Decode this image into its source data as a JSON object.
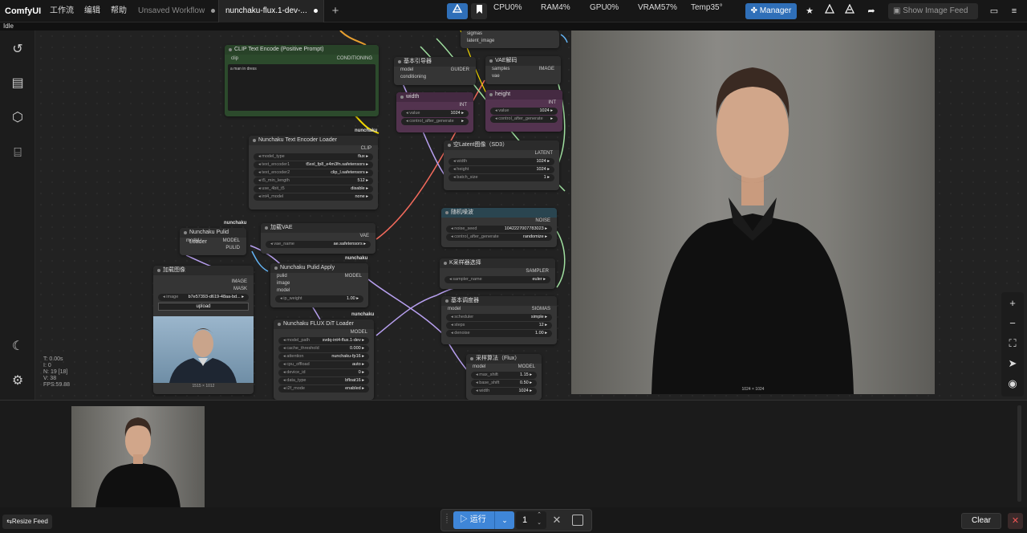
{
  "app": {
    "brand": "ComfyUI",
    "status": "Idle"
  },
  "menu": [
    "工作流",
    "编辑",
    "帮助"
  ],
  "tabs": [
    {
      "label": "Unsaved Workflow",
      "active": false
    },
    {
      "label": "nunchaku-flux.1-dev-...",
      "active": true
    }
  ],
  "system_stats": {
    "cpu": "CPU0%",
    "ram": "RAM4%",
    "gpu": "GPU0%",
    "vram": "VRAM57%",
    "temp": "Temp35°"
  },
  "toolbar": {
    "manager_label": "Manager",
    "show_feed_label": "Show Image Feed"
  },
  "stats_overlay": [
    "T: 0.00s",
    "I: 0",
    "N: 19 [18]",
    "V: 38",
    "FPS:59.88"
  ],
  "nodes": {
    "clip_text_encode": {
      "title": "CLIP Text Encode (Positive Prompt)",
      "in": "clip",
      "out": "CONDITIONING",
      "text": "a man in dress"
    },
    "text_encoder_loader": {
      "title": "Nunchaku Text Encoder Loader",
      "out": "CLIP",
      "tag": "nunchaku",
      "widgets": [
        [
          "model_type",
          "flux"
        ],
        [
          "text_encoder1",
          "t5xxl_fp8_e4m3fn.safetensors"
        ],
        [
          "text_encoder2",
          "clip_l.safetensors"
        ],
        [
          "t5_min_length",
          "512"
        ],
        [
          "use_4bit_t5",
          "disable"
        ],
        [
          "int4_model",
          "none"
        ]
      ]
    },
    "load_vae": {
      "title": "加载VAE",
      "out": "VAE",
      "widgets": [
        [
          "vae_name",
          "ae.safetensors"
        ]
      ]
    },
    "pulid_loader": {
      "title": "Nunchaku Pulid Loader",
      "in": "model",
      "outs": [
        "MODEL",
        "PULID"
      ],
      "tag": "nunchaku"
    },
    "pulid_apply": {
      "title": "Nunchaku Pulid Apply",
      "ins": [
        "pulid",
        "image",
        "model"
      ],
      "out": "MODEL",
      "tag": "nunchaku",
      "widgets": [
        [
          "ip_weight",
          "1.00"
        ]
      ]
    },
    "load_image": {
      "title": "加载图像",
      "outs": [
        "IMAGE",
        "MASK"
      ],
      "widgets": [
        [
          "image",
          "b7e57393-d619-48aa-bd..."
        ]
      ],
      "upload": "upload",
      "caption": "1515 × 1012"
    },
    "dit_loader": {
      "title": "Nunchaku FLUX DiT Loader",
      "out": "MODEL",
      "tag": "nunchaku",
      "widgets": [
        [
          "model_path",
          "svdq-int4-flux.1-dev"
        ],
        [
          "cache_threshold",
          "0.000"
        ],
        [
          "attention",
          "nunchaku-fp16"
        ],
        [
          "cpu_offload",
          "auto"
        ],
        [
          "device_id",
          "0"
        ],
        [
          "data_type",
          "bfloat16"
        ],
        [
          "i2f_mode",
          "enabled"
        ]
      ]
    },
    "basic_guider": {
      "title": "基本引导器",
      "ins": [
        "model",
        "conditioning"
      ],
      "out": "GUIDER"
    },
    "vae_decode": {
      "title": "VAE解码",
      "ins": [
        "samples",
        "vae"
      ],
      "out": "IMAGE"
    },
    "width": {
      "title": "width",
      "out": "INT",
      "widgets": [
        [
          "value",
          "1024"
        ],
        [
          "control_after_generate",
          ""
        ]
      ]
    },
    "height": {
      "title": "height",
      "out": "INT",
      "widgets": [
        [
          "value",
          "1024"
        ],
        [
          "control_after_generate",
          ""
        ]
      ]
    },
    "top_partial": {
      "ins": [
        "sigmas",
        "latent_image"
      ]
    },
    "empty_latent": {
      "title": "空Latent图像（SD3）",
      "out": "LATENT",
      "widgets": [
        [
          "width",
          "1024"
        ],
        [
          "height",
          "1024"
        ],
        [
          "batch_size",
          "1"
        ]
      ]
    },
    "random_noise": {
      "title": "随机噪波",
      "out": "NOISE",
      "widgets": [
        [
          "noise_seed",
          "1042227007783023"
        ],
        [
          "control_after_generate",
          "randomize"
        ]
      ]
    },
    "ksampler_select": {
      "title": "K采样器选择",
      "out": "SAMPLER",
      "widgets": [
        [
          "sampler_name",
          "euler"
        ]
      ]
    },
    "basic_scheduler": {
      "title": "基本调度器",
      "in": "model",
      "out": "SIGMAS",
      "widgets": [
        [
          "scheduler",
          "simple"
        ],
        [
          "steps",
          "12"
        ],
        [
          "denoise",
          "1.00"
        ]
      ]
    },
    "model_sampling_flux": {
      "title": "采样算法（Flux）",
      "in": "model",
      "out": "MODEL",
      "widgets": [
        [
          "max_shift",
          "1.15"
        ],
        [
          "base_shift",
          "0.50"
        ],
        [
          "width",
          "1024"
        ]
      ]
    }
  },
  "preview": {
    "caption": "1024 × 1024"
  },
  "bottom": {
    "resize_feed": "Resize Feed",
    "run_label": "运行",
    "queue_count": "1",
    "clear": "Clear"
  },
  "colors": {
    "accent": "#3f86d8",
    "node_bg": "#353535",
    "canvas_bg": "#222222"
  }
}
